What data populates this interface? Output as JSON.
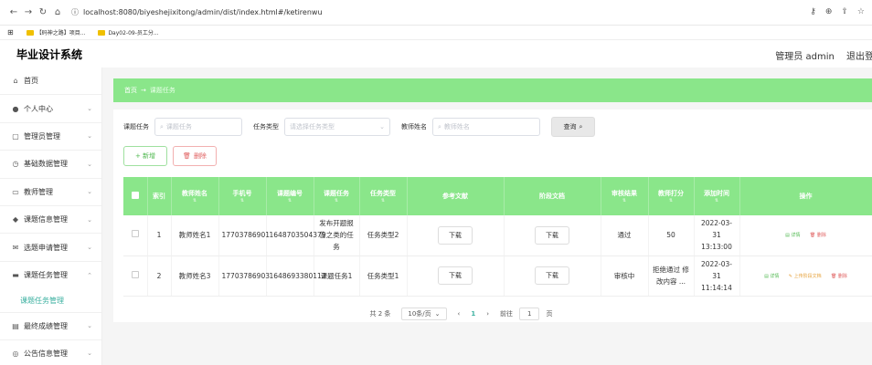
{
  "browser": {
    "url": "localhost:8080/biyeshejixitong/admin/dist/index.html#/ketirenwu",
    "bookmarks": [
      "【码神之路】项目...",
      "Day02-09-员工分..."
    ]
  },
  "header": {
    "system_title": "毕业设计系统",
    "user_label": "管理员 admin",
    "logout_label": "退出登"
  },
  "sidebar": {
    "items": [
      {
        "label": "首页",
        "icon": "home-icon",
        "glyph": "⌂"
      },
      {
        "label": "个人中心",
        "icon": "user-icon",
        "glyph": "●"
      },
      {
        "label": "管理员管理",
        "icon": "chat-icon",
        "glyph": "▢"
      },
      {
        "label": "基础数据管理",
        "icon": "clock-icon",
        "glyph": "◷"
      },
      {
        "label": "教师管理",
        "icon": "card-icon",
        "glyph": "▭"
      },
      {
        "label": "课题信息管理",
        "icon": "pin-icon",
        "glyph": "◆"
      },
      {
        "label": "选题申请管理",
        "icon": "mail-icon",
        "glyph": "✉"
      },
      {
        "label": "课题任务管理",
        "icon": "monitor-icon",
        "glyph": "▬"
      }
    ],
    "submenu_label": "课题任务管理",
    "items_after": [
      {
        "label": "最终成绩管理",
        "icon": "doc-icon",
        "glyph": "▤"
      },
      {
        "label": "公告信息管理",
        "icon": "globe-icon",
        "glyph": "◎"
      }
    ]
  },
  "breadcrumb": {
    "home": "首页",
    "separator": "→",
    "current": "课题任务"
  },
  "search": {
    "task_label": "课题任务",
    "task_placeholder": "课题任务",
    "type_label": "任务类型",
    "type_placeholder": "请选择任务类型",
    "teacher_label": "教师姓名",
    "teacher_placeholder": "教师姓名",
    "query_label": "查询"
  },
  "actions": {
    "add_label": "+ 新增",
    "delete_label": "删除"
  },
  "table": {
    "headers": [
      "索引",
      "教师姓名",
      "手机号",
      "课题编号",
      "课题任务",
      "任务类型",
      "参考文献",
      "阶段文档",
      "审核结果",
      "教师打分",
      "添加时间",
      "操作"
    ],
    "rows": [
      {
        "index": "1",
        "teacher": "教师姓名1",
        "phone": "17703786901",
        "code": "1648703504379",
        "task": "发布开题报告之类的任务",
        "type": "任务类型2",
        "ref": "下载",
        "doc": "下载",
        "result": "通过",
        "score": "50",
        "time": "2022-03-31 13:13:00",
        "ops": [
          "详情",
          "删除"
        ]
      },
      {
        "index": "2",
        "teacher": "教师姓名3",
        "phone": "17703786903",
        "code": "1648693380112",
        "task": "课题任务1",
        "type": "任务类型1",
        "ref": "下载",
        "doc": "下载",
        "result": "审核中",
        "score": "拒绝通过 修改内容 ...",
        "time": "2022-03-31 11:14:14",
        "ops": [
          "详情",
          "上传阶段文档",
          "删除"
        ]
      }
    ]
  },
  "pager": {
    "total": "共 2 条",
    "page_size": "10条/页",
    "current": "1",
    "goto_label": "前往",
    "goto_value": "1",
    "page_suffix": "页"
  }
}
